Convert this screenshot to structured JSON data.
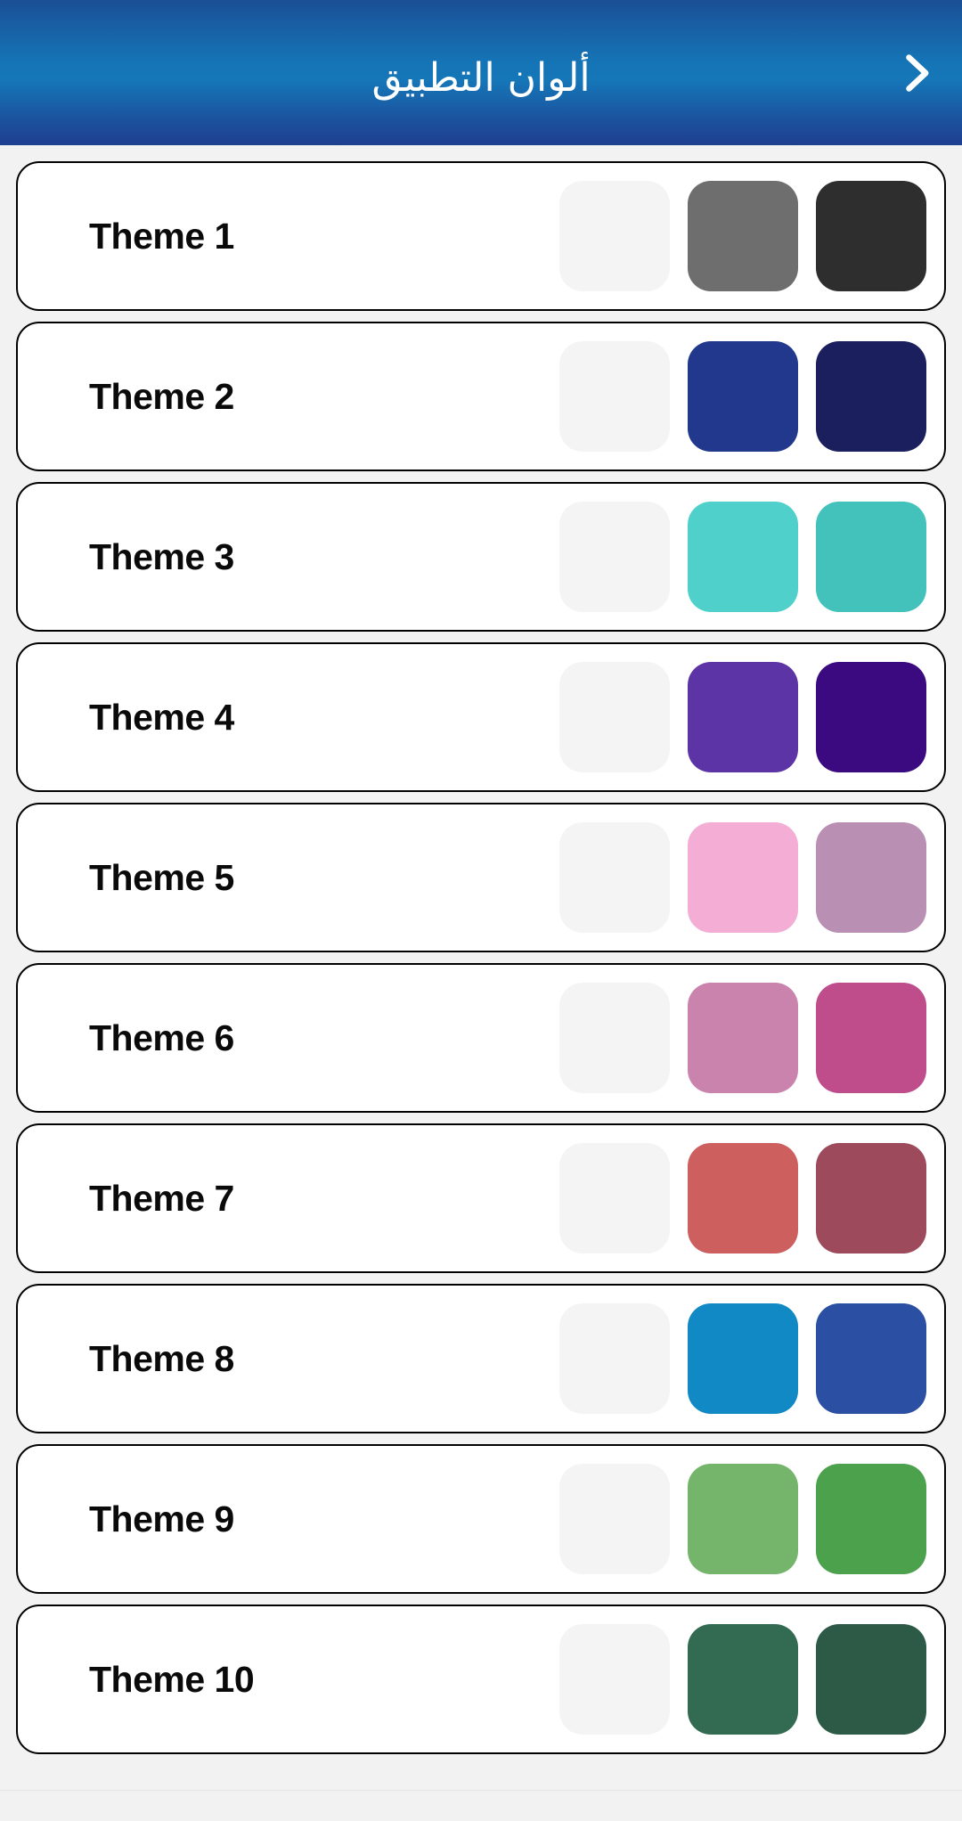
{
  "header": {
    "title": "ألوان التطبيق",
    "forward_icon": "chevron-right-icon",
    "gradient_top": "#1b4f96",
    "gradient_mid": "#1577b8",
    "gradient_bottom": "#1f3f8f",
    "title_color": "#ffffff"
  },
  "page": {
    "background": "#f2f2f2",
    "card_background": "#ffffff",
    "card_border": "#000000"
  },
  "themes": [
    {
      "label": "Theme 1",
      "colors": [
        "#f4f4f4",
        "#6e6e6e",
        "#2e2e2e"
      ]
    },
    {
      "label": "Theme 2",
      "colors": [
        "#f4f4f4",
        "#21388d",
        "#1b1f5e"
      ]
    },
    {
      "label": "Theme 3",
      "colors": [
        "#f4f4f4",
        "#4fd0cb",
        "#42c2bb"
      ]
    },
    {
      "label": "Theme 4",
      "colors": [
        "#f4f4f4",
        "#5d34a6",
        "#3c0a80"
      ]
    },
    {
      "label": "Theme 5",
      "colors": [
        "#f4f4f4",
        "#f4aed5",
        "#b98fb4"
      ]
    },
    {
      "label": "Theme 6",
      "colors": [
        "#f4f4f4",
        "#c983ac",
        "#bf4d8c"
      ]
    },
    {
      "label": "Theme 7",
      "colors": [
        "#f4f4f4",
        "#ce5f5f",
        "#9d4a5c"
      ]
    },
    {
      "label": "Theme 8",
      "colors": [
        "#f4f4f4",
        "#1189c4",
        "#2b4fa2"
      ]
    },
    {
      "label": "Theme 9",
      "colors": [
        "#f4f4f4",
        "#74b56b",
        "#4ca14c"
      ]
    },
    {
      "label": "Theme 10",
      "colors": [
        "#f4f4f4",
        "#336b52",
        "#2c5a47"
      ]
    }
  ]
}
